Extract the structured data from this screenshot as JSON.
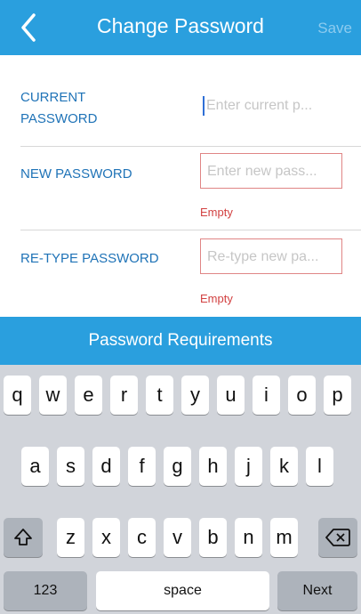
{
  "header": {
    "back_icon": "chevron-left-icon",
    "title": "Change Password",
    "save_label": "Save"
  },
  "form": {
    "current": {
      "label_line1": "CURRENT",
      "label_line2": "PASSWORD",
      "placeholder": "Enter current p..."
    },
    "new": {
      "label": "NEW PASSWORD",
      "placeholder": "Enter new pass...",
      "error": "Empty"
    },
    "retype": {
      "label": "RE-TYPE PASSWORD",
      "placeholder": "Re-type new pa...",
      "error": "Empty"
    }
  },
  "requirements_label": "Password Requirements",
  "keyboard": {
    "row1": [
      "q",
      "w",
      "e",
      "r",
      "t",
      "y",
      "u",
      "i",
      "o",
      "p"
    ],
    "row2": [
      "a",
      "s",
      "d",
      "f",
      "g",
      "h",
      "j",
      "k",
      "l"
    ],
    "row3": [
      "z",
      "x",
      "c",
      "v",
      "b",
      "n",
      "m"
    ],
    "shift_icon": "shift-icon",
    "delete_icon": "backspace-icon",
    "numbers_label": "123",
    "space_label": "space",
    "next_label": "Next"
  },
  "colors": {
    "accent": "#2a9fde",
    "label": "#1f73b7",
    "error": "#d24141"
  }
}
